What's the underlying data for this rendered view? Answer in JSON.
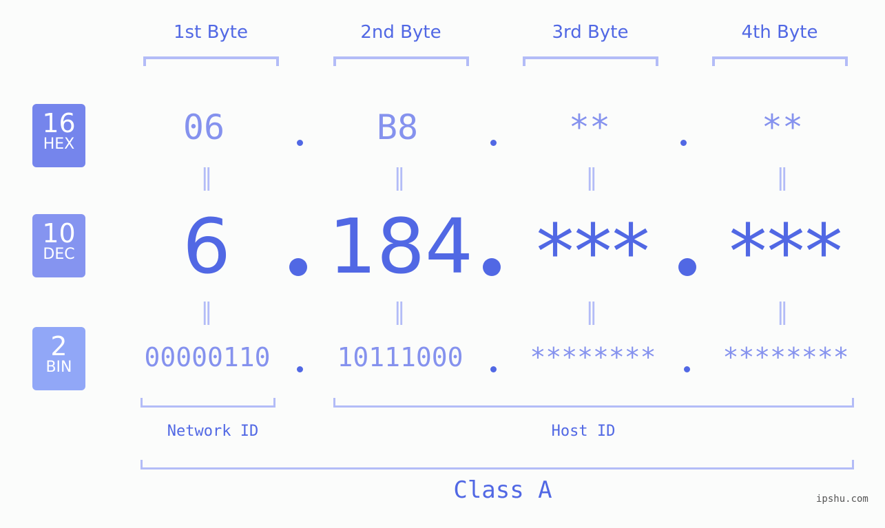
{
  "headers": [
    "1st Byte",
    "2nd Byte",
    "3rd Byte",
    "4th Byte"
  ],
  "badges": [
    {
      "num": "16",
      "label": "HEX",
      "color": "#7585ec"
    },
    {
      "num": "10",
      "label": "DEC",
      "color": "#8594f0"
    },
    {
      "num": "2",
      "label": "BIN",
      "color": "#91a7f7"
    }
  ],
  "hex": [
    "06",
    "B8",
    "**",
    "**"
  ],
  "dec": [
    "6",
    "184",
    "***",
    "***"
  ],
  "bin": [
    "00000110",
    "10111000",
    "********",
    "********"
  ],
  "equals": "=",
  "labels": {
    "network": "Network ID",
    "host": "Host ID",
    "class": "Class A"
  },
  "watermark": "ipshu.com",
  "colors": {
    "accent": "#5168e4",
    "light": "#8592ee",
    "bracket": "#b3bcf7"
  }
}
